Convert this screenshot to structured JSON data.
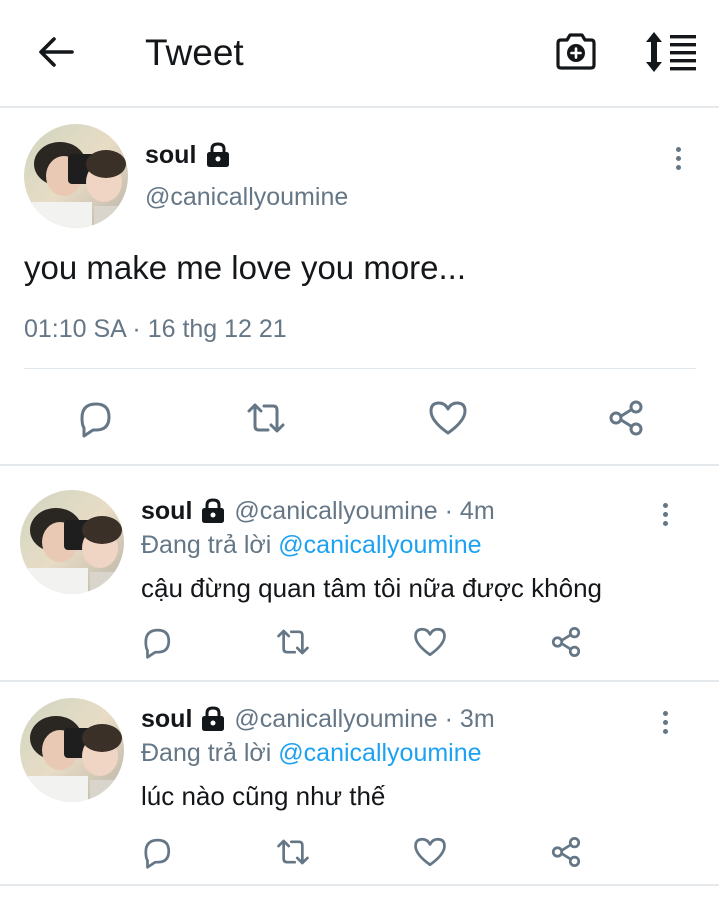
{
  "header": {
    "title": "Tweet",
    "back_icon": "arrow-left-icon",
    "camera_icon": "camera-plus-icon",
    "sort_icon": "sort-icon"
  },
  "main_tweet": {
    "display_name": "soul",
    "handle": "@canicallyoumine",
    "text": "you make me love you more...",
    "timestamp": "01:10 SA · 16 thg 12 21",
    "actions": [
      "reply-icon",
      "retweet-icon",
      "like-icon",
      "share-icon"
    ]
  },
  "replies": [
    {
      "display_name": "soul",
      "handle": "@canicallyoumine",
      "time_ago": "· 4m",
      "replying_prefix": "Đang trả lời",
      "replying_mention": "@canicallyoumine",
      "text": "cậu đừng quan tâm tôi nữa được không"
    },
    {
      "display_name": "soul",
      "handle": "@canicallyoumine",
      "time_ago": "· 3m",
      "replying_prefix": "Đang trả lời",
      "replying_mention": "@canicallyoumine",
      "text": "lúc nào cũng như thế"
    }
  ],
  "colors": {
    "text": "#14171a",
    "secondary": "#657786",
    "mention": "#1da1f2",
    "divider": "#e6e9ec"
  }
}
